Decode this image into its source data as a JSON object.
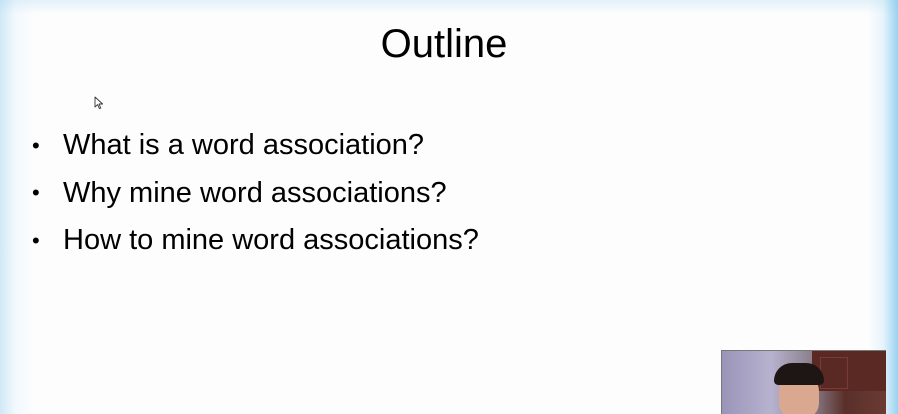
{
  "slide": {
    "title": "Outline",
    "bullets": [
      "What is a word association?",
      "Why mine word associations?",
      "How to mine word associations?"
    ],
    "bullet_symbol": "•"
  },
  "colors": {
    "text": "#000000",
    "background": "#fdfdfe",
    "accent": "#78c3eb"
  },
  "icons": {
    "cursor": "mouse-pointer-icon"
  }
}
